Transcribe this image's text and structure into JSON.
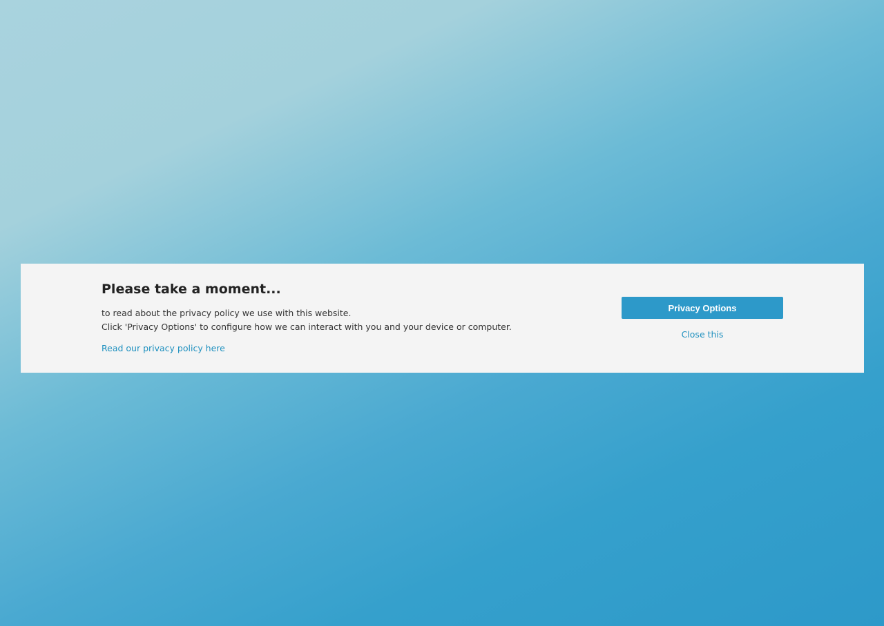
{
  "banner": {
    "title": "Please take a moment...",
    "body_lines": [
      "to read about the privacy policy we use with this website.",
      "Click 'Privacy Options' to configure how we can interact with you and your device or computer."
    ],
    "policy_link_label": "Read our privacy policy here",
    "privacy_options_label": "Privacy Options",
    "close_label": "Close this"
  },
  "colors": {
    "banner_background": "#f4f4f4",
    "accent": "#2d99c9",
    "link": "#1e90bf",
    "title_text": "#222222",
    "body_text": "#333333"
  }
}
